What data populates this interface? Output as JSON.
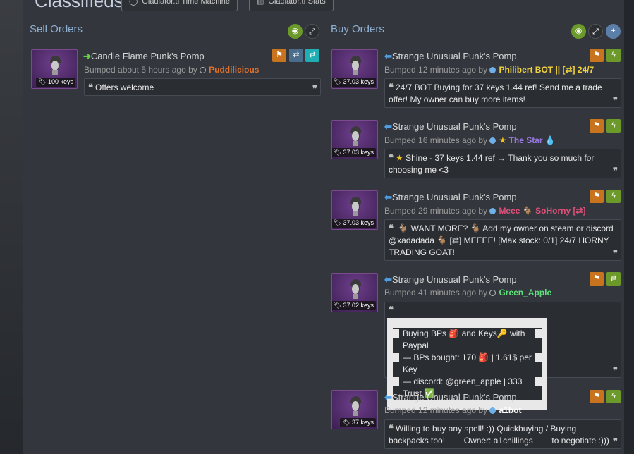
{
  "header": {
    "title": "Classifieds",
    "tab1": "Gladiator.tf Time Machine",
    "tab2": "Gladiator.tf Stats"
  },
  "sell": {
    "title": "Sell Orders",
    "orders": [
      {
        "price": "100 keys",
        "name": "Candle Flame Punk's Pomp",
        "bumped": "Bumped about 5 hours ago by",
        "user": "Puddilicious",
        "user_color": "#e0702a",
        "message": "Offers welcome"
      }
    ]
  },
  "buy": {
    "title": "Buy Orders",
    "orders": [
      {
        "price": "37.03 keys",
        "name": "Strange Unusual Punk's Pomp",
        "bumped": "Bumped 12 minutes ago by",
        "user": "Philibert BOT || [⇄] 24/7",
        "user_color": "#f0d23c",
        "message": "24/7 BOT Buying for 37 keys 1.44 ref! Send me a trade offer! My owner can buy more items!"
      },
      {
        "price": "37.03 keys",
        "name": "Strange Unusual Punk's Pomp",
        "bumped": "Bumped 16 minutes ago by",
        "user": "The Star",
        "user_color": "#9a78e0",
        "message": "Shine - 37 keys 1.44 ref → Thank you so much for choosing me <3"
      },
      {
        "price": "37.03 keys",
        "name": "Strange Unusual Punk's Pomp",
        "bumped": "Bumped 29 minutes ago by",
        "user_a": "Meee",
        "user_b": "SoHorny [⇄]",
        "user_color": "#e0507a",
        "message_a": "WANT MORE?",
        "message_b": "Add my owner on steam or discord @xadadada",
        "message_c": "[⇄] MEEEE! [Max stock: 0/1] 24/7 HORNY TRADING GOAT!"
      },
      {
        "price": "37.02 keys",
        "name": "Strange Unusual Punk's Pomp",
        "bumped": "Bumped 41 minutes ago by",
        "user": "Green_Apple",
        "user_color": "#5ee07a",
        "line1_a": "Buying BPs",
        "line1_b": "and Keys",
        "line1_c": "with Paypal",
        "line2_a": "— BPs bought: 170",
        "line2_b": "| 1.61$ per Key",
        "line3": "— discord: @green_apple | 333 Trust"
      },
      {
        "price": "37 keys",
        "name": "Strange Unusual Punk's Pomp",
        "bumped": "Bumped 12 minutes ago by",
        "user": "a1bot",
        "user_color": "#ffffff",
        "message": "Willing to buy any spell! :)) Quickbuying / Buying backpacks too!        Owner: a1chillings        to negotiate :)))"
      }
    ]
  }
}
